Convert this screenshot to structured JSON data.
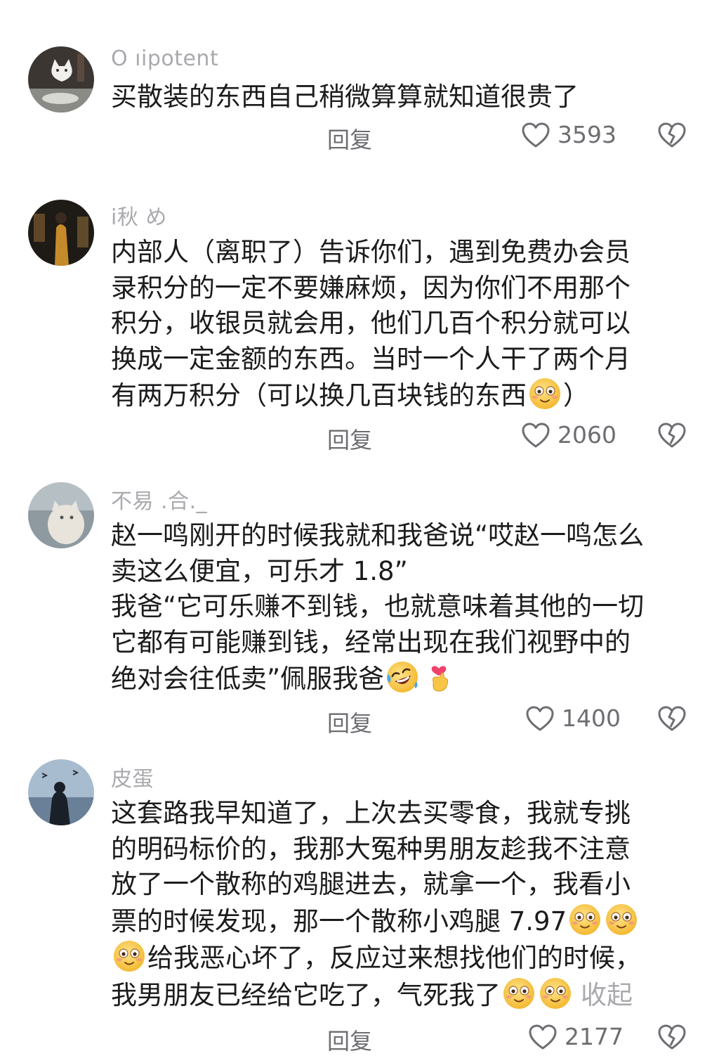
{
  "comments": [
    {
      "username": "O   ıipotent",
      "lines": [
        "买散装的东西自己稍微算算就知道很贵了"
      ],
      "reply_label": "回复",
      "likes": "3593"
    },
    {
      "username": "i秋        め",
      "lines": [
        "内部人（离职了）告诉你们，遇到免费办会员",
        "录积分的一定不要嫌麻烦，因为你们不用那个",
        "积分，收银员就会用，他们几百个积分就可以",
        "换成一定金额的东西。当时一个人干了两个月",
        "有两万积分（可以换几百块钱的东西",
        "）"
      ],
      "reply_label": "回复",
      "likes": "2060"
    },
    {
      "username": "不易      .合._",
      "lines": [
        "赵一鸣刚开的时候我就和我爸说“哎赵一鸣怎么",
        "卖这么便宜，可乐才 1.8”",
        "我爸“它可乐赚不到钱，也就意味着其他的一切",
        "它都有可能赚到钱，经常出现在我们视野中的",
        "绝对会往低卖”佩服我爸"
      ],
      "reply_label": "回复",
      "likes": "1400"
    },
    {
      "username": "皮蛋",
      "lines": [
        "这套路我早知道了，上次去买零食，我就专挑",
        "的明码标价的，我那大冤种男朋友趁我不注意",
        "放了一个散称的鸡腿进去，就拿一个，我看小",
        "票的时候发现，那一个散称小鸡腿 7.97",
        "给我恶心坏了，反应过来想找他们的时候，",
        "我男朋友已经给它吃了，气死我了"
      ],
      "collapse_label": "收起",
      "reply_label": "回复",
      "likes": "2177"
    }
  ],
  "icons": {
    "like": "heart-outline-icon",
    "dislike": "broken-heart-icon",
    "emoji_smile": "flushed-smile-emoji",
    "emoji_laugh": "rolling-laughing-emoji",
    "emoji_heart_hand": "finger-heart-emoji"
  },
  "colors": {
    "text": "#1c1c1e",
    "username": "#a9a9ae",
    "meta": "#6d6d72",
    "emoji_face": "#f9c740"
  }
}
